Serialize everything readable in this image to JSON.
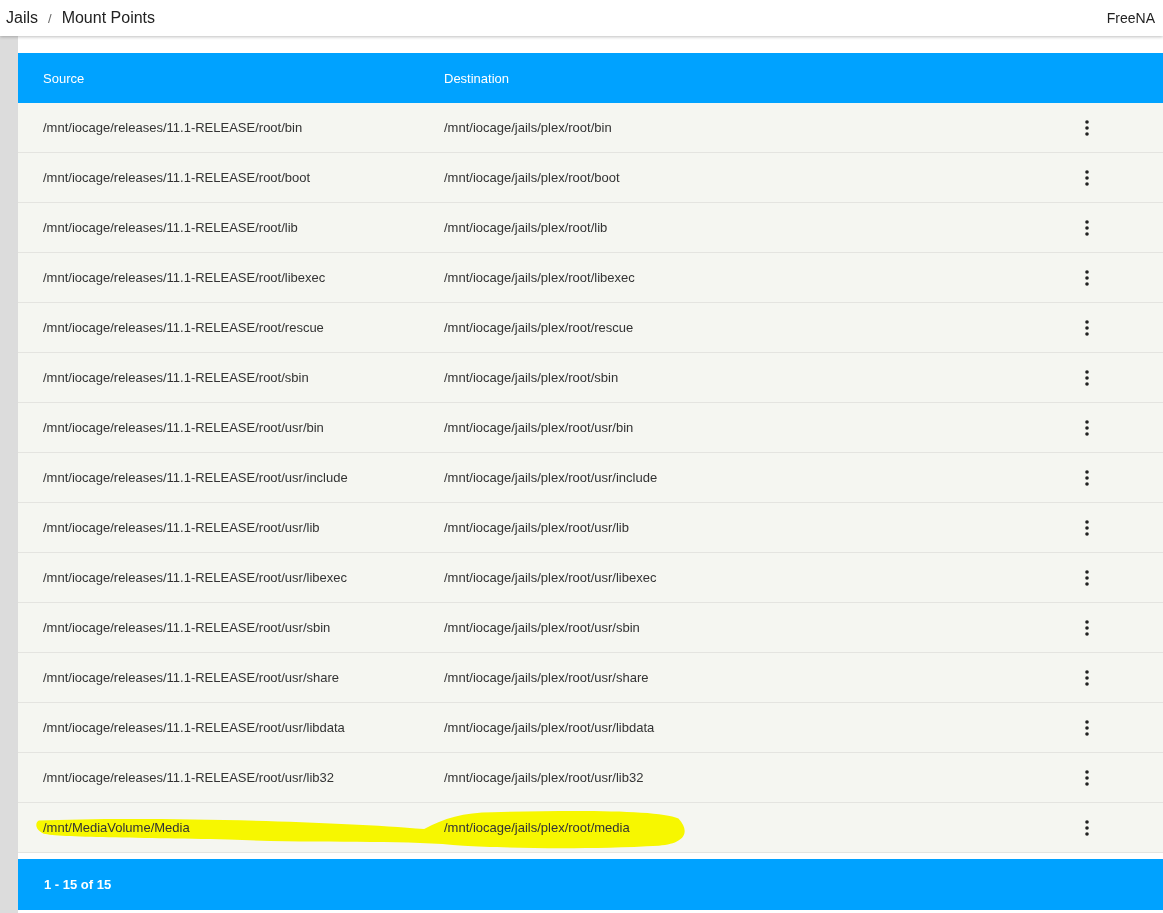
{
  "breadcrumb": [
    {
      "label": "Jails"
    },
    {
      "label": "Mount Points"
    }
  ],
  "breadcrumb_separator": "/",
  "brand": "FreeNA",
  "table": {
    "columns": [
      "Source",
      "Destination"
    ],
    "rows": [
      {
        "source": "/mnt/iocage/releases/11.1-RELEASE/root/bin",
        "destination": "/mnt/iocage/jails/plex/root/bin",
        "highlighted": false
      },
      {
        "source": "/mnt/iocage/releases/11.1-RELEASE/root/boot",
        "destination": "/mnt/iocage/jails/plex/root/boot",
        "highlighted": false
      },
      {
        "source": "/mnt/iocage/releases/11.1-RELEASE/root/lib",
        "destination": "/mnt/iocage/jails/plex/root/lib",
        "highlighted": false
      },
      {
        "source": "/mnt/iocage/releases/11.1-RELEASE/root/libexec",
        "destination": "/mnt/iocage/jails/plex/root/libexec",
        "highlighted": false
      },
      {
        "source": "/mnt/iocage/releases/11.1-RELEASE/root/rescue",
        "destination": "/mnt/iocage/jails/plex/root/rescue",
        "highlighted": false
      },
      {
        "source": "/mnt/iocage/releases/11.1-RELEASE/root/sbin",
        "destination": "/mnt/iocage/jails/plex/root/sbin",
        "highlighted": false
      },
      {
        "source": "/mnt/iocage/releases/11.1-RELEASE/root/usr/bin",
        "destination": "/mnt/iocage/jails/plex/root/usr/bin",
        "highlighted": false
      },
      {
        "source": "/mnt/iocage/releases/11.1-RELEASE/root/usr/include",
        "destination": "/mnt/iocage/jails/plex/root/usr/include",
        "highlighted": false
      },
      {
        "source": "/mnt/iocage/releases/11.1-RELEASE/root/usr/lib",
        "destination": "/mnt/iocage/jails/plex/root/usr/lib",
        "highlighted": false
      },
      {
        "source": "/mnt/iocage/releases/11.1-RELEASE/root/usr/libexec",
        "destination": "/mnt/iocage/jails/plex/root/usr/libexec",
        "highlighted": false
      },
      {
        "source": "/mnt/iocage/releases/11.1-RELEASE/root/usr/sbin",
        "destination": "/mnt/iocage/jails/plex/root/usr/sbin",
        "highlighted": false
      },
      {
        "source": "/mnt/iocage/releases/11.1-RELEASE/root/usr/share",
        "destination": "/mnt/iocage/jails/plex/root/usr/share",
        "highlighted": false
      },
      {
        "source": "/mnt/iocage/releases/11.1-RELEASE/root/usr/libdata",
        "destination": "/mnt/iocage/jails/plex/root/usr/libdata",
        "highlighted": false
      },
      {
        "source": "/mnt/iocage/releases/11.1-RELEASE/root/usr/lib32",
        "destination": "/mnt/iocage/jails/plex/root/usr/lib32",
        "highlighted": false
      },
      {
        "source": "/mnt/MediaVolume/Media",
        "destination": "/mnt/iocage/jails/plex/root/media",
        "highlighted": true
      }
    ],
    "pagination": "1 - 15 of 15"
  }
}
